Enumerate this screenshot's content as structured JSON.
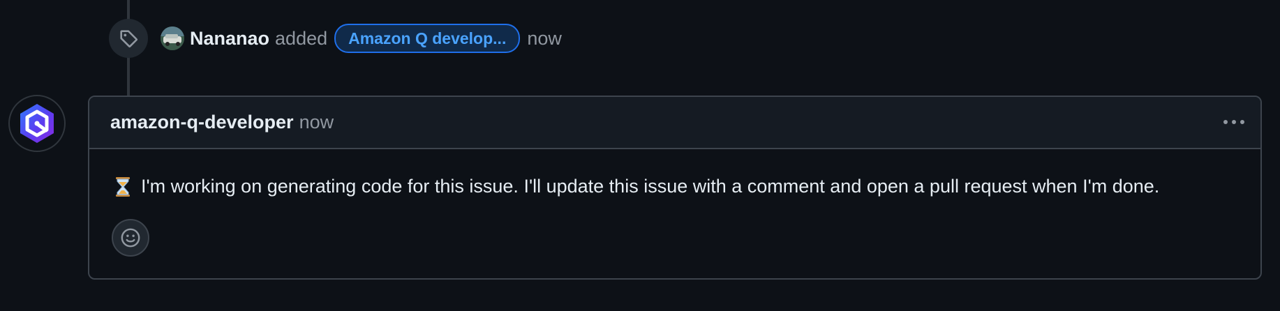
{
  "timeline_event": {
    "icon": "tag-icon",
    "actor": "Nananao",
    "verb": "added",
    "label": "Amazon Q develop...",
    "label_color": "#4aa3ff",
    "time": "now"
  },
  "comment": {
    "avatar_icon": "amazon-q-logo-icon",
    "author": "amazon-q-developer",
    "time": "now",
    "menu_icon": "kebab-horizontal-icon",
    "body_icon": "hourglass-icon",
    "body": "I'm working on generating code for this issue. I'll update this issue with a comment and open a pull request when I'm done.",
    "reaction_icon": "smiley-icon"
  }
}
